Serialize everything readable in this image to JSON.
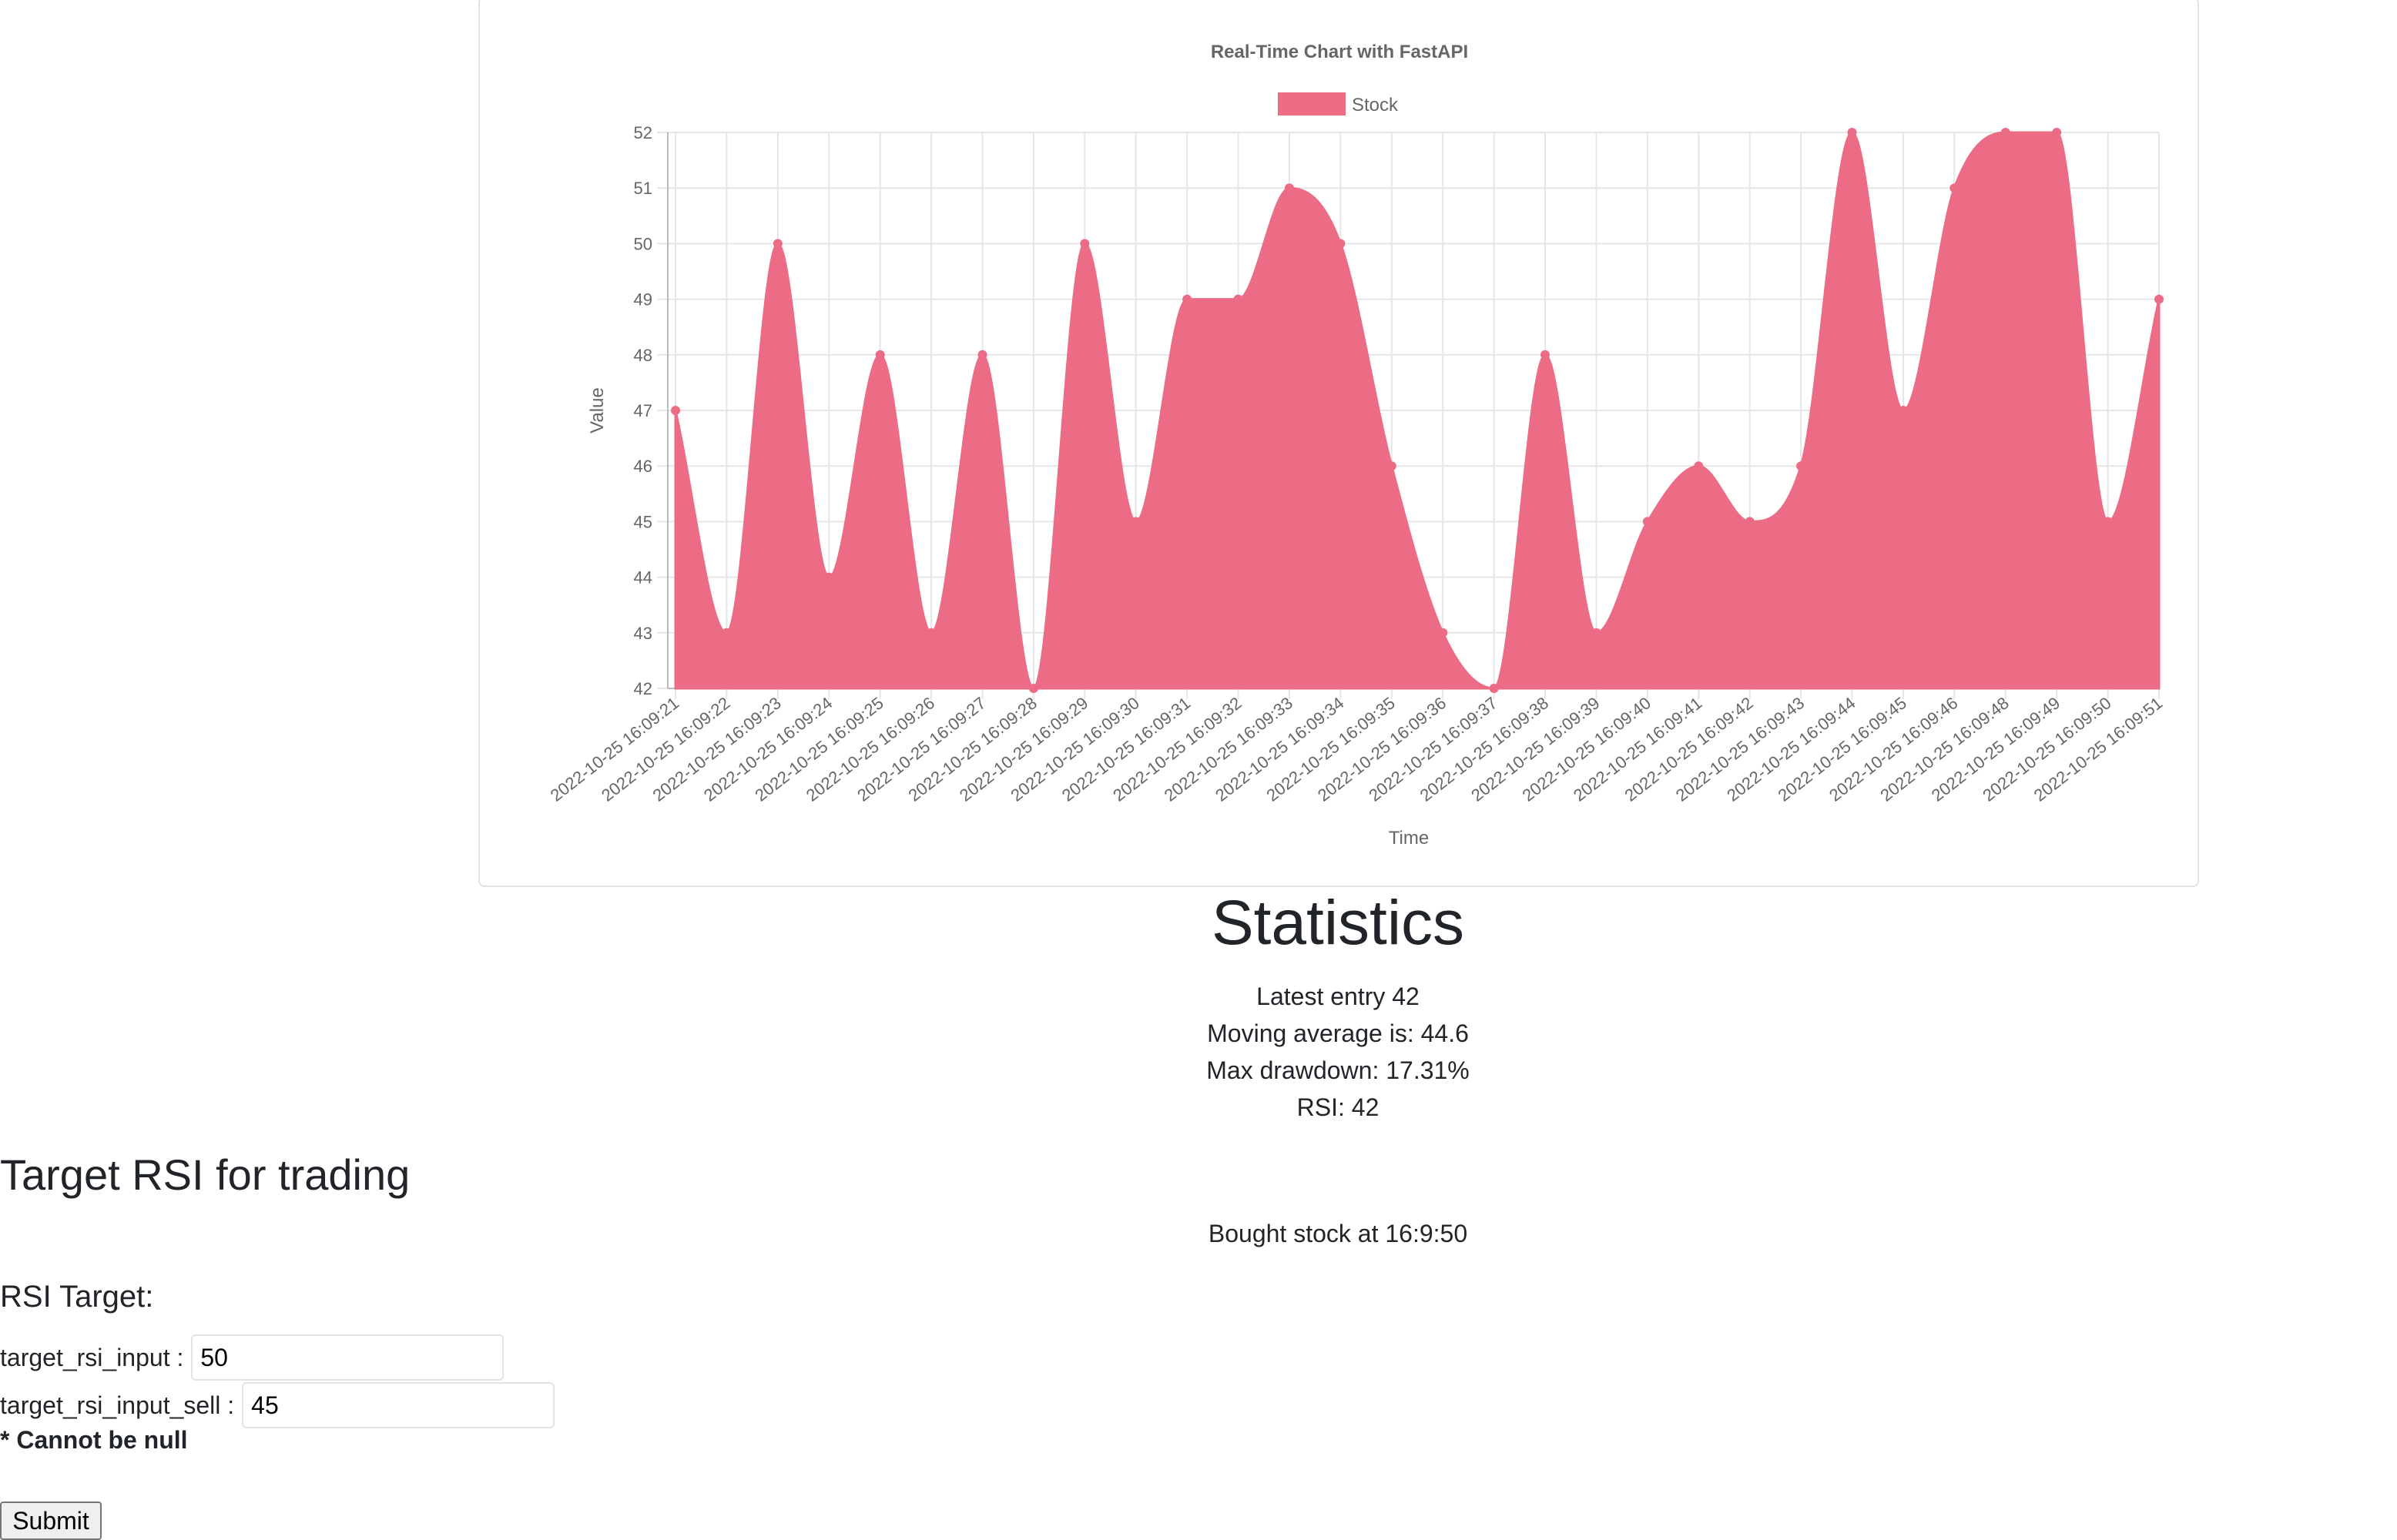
{
  "chart_data": {
    "type": "area",
    "title": "Real-Time Chart with FastAPI",
    "xlabel": "Time",
    "ylabel": "Value",
    "legend": {
      "position": "top",
      "entries": [
        "Stock"
      ]
    },
    "grid": true,
    "ylim": [
      42,
      52
    ],
    "yticks": [
      42,
      43,
      44,
      45,
      46,
      47,
      48,
      49,
      50,
      51,
      52
    ],
    "x": [
      "2022-10-25 16:09:21",
      "2022-10-25 16:09:22",
      "2022-10-25 16:09:23",
      "2022-10-25 16:09:24",
      "2022-10-25 16:09:25",
      "2022-10-25 16:09:26",
      "2022-10-25 16:09:27",
      "2022-10-25 16:09:28",
      "2022-10-25 16:09:29",
      "2022-10-25 16:09:30",
      "2022-10-25 16:09:31",
      "2022-10-25 16:09:32",
      "2022-10-25 16:09:33",
      "2022-10-25 16:09:34",
      "2022-10-25 16:09:35",
      "2022-10-25 16:09:36",
      "2022-10-25 16:09:37",
      "2022-10-25 16:09:38",
      "2022-10-25 16:09:39",
      "2022-10-25 16:09:40",
      "2022-10-25 16:09:41",
      "2022-10-25 16:09:42",
      "2022-10-25 16:09:43",
      "2022-10-25 16:09:44",
      "2022-10-25 16:09:45",
      "2022-10-25 16:09:46",
      "2022-10-25 16:09:48",
      "2022-10-25 16:09:49",
      "2022-10-25 16:09:50",
      "2022-10-25 16:09:51"
    ],
    "series": [
      {
        "name": "Stock",
        "color": "#ec6c86",
        "values": [
          47,
          43,
          50,
          44,
          48,
          43,
          48,
          42,
          50,
          45,
          49,
          49,
          51,
          50,
          46,
          43,
          42,
          48,
          43,
          45,
          46,
          45,
          46,
          52,
          47,
          51,
          52,
          52,
          45,
          49
        ]
      }
    ]
  },
  "statistics": {
    "title": "Statistics",
    "latest_entry": "Latest entry 42",
    "moving_average": "Moving average is: 44.6",
    "max_drawdown": "Max drawdown: 17.31%",
    "rsi": "RSI: 42",
    "bought_message": "Bought stock at 16:9:50"
  },
  "form": {
    "title": "Target RSI for trading",
    "section_label": "RSI Target:",
    "buy_label": "target_rsi_input :",
    "buy_value": "50",
    "sell_label": "target_rsi_input_sell :",
    "sell_value": "45",
    "note": "* Cannot be null",
    "submit_label": "Submit"
  }
}
